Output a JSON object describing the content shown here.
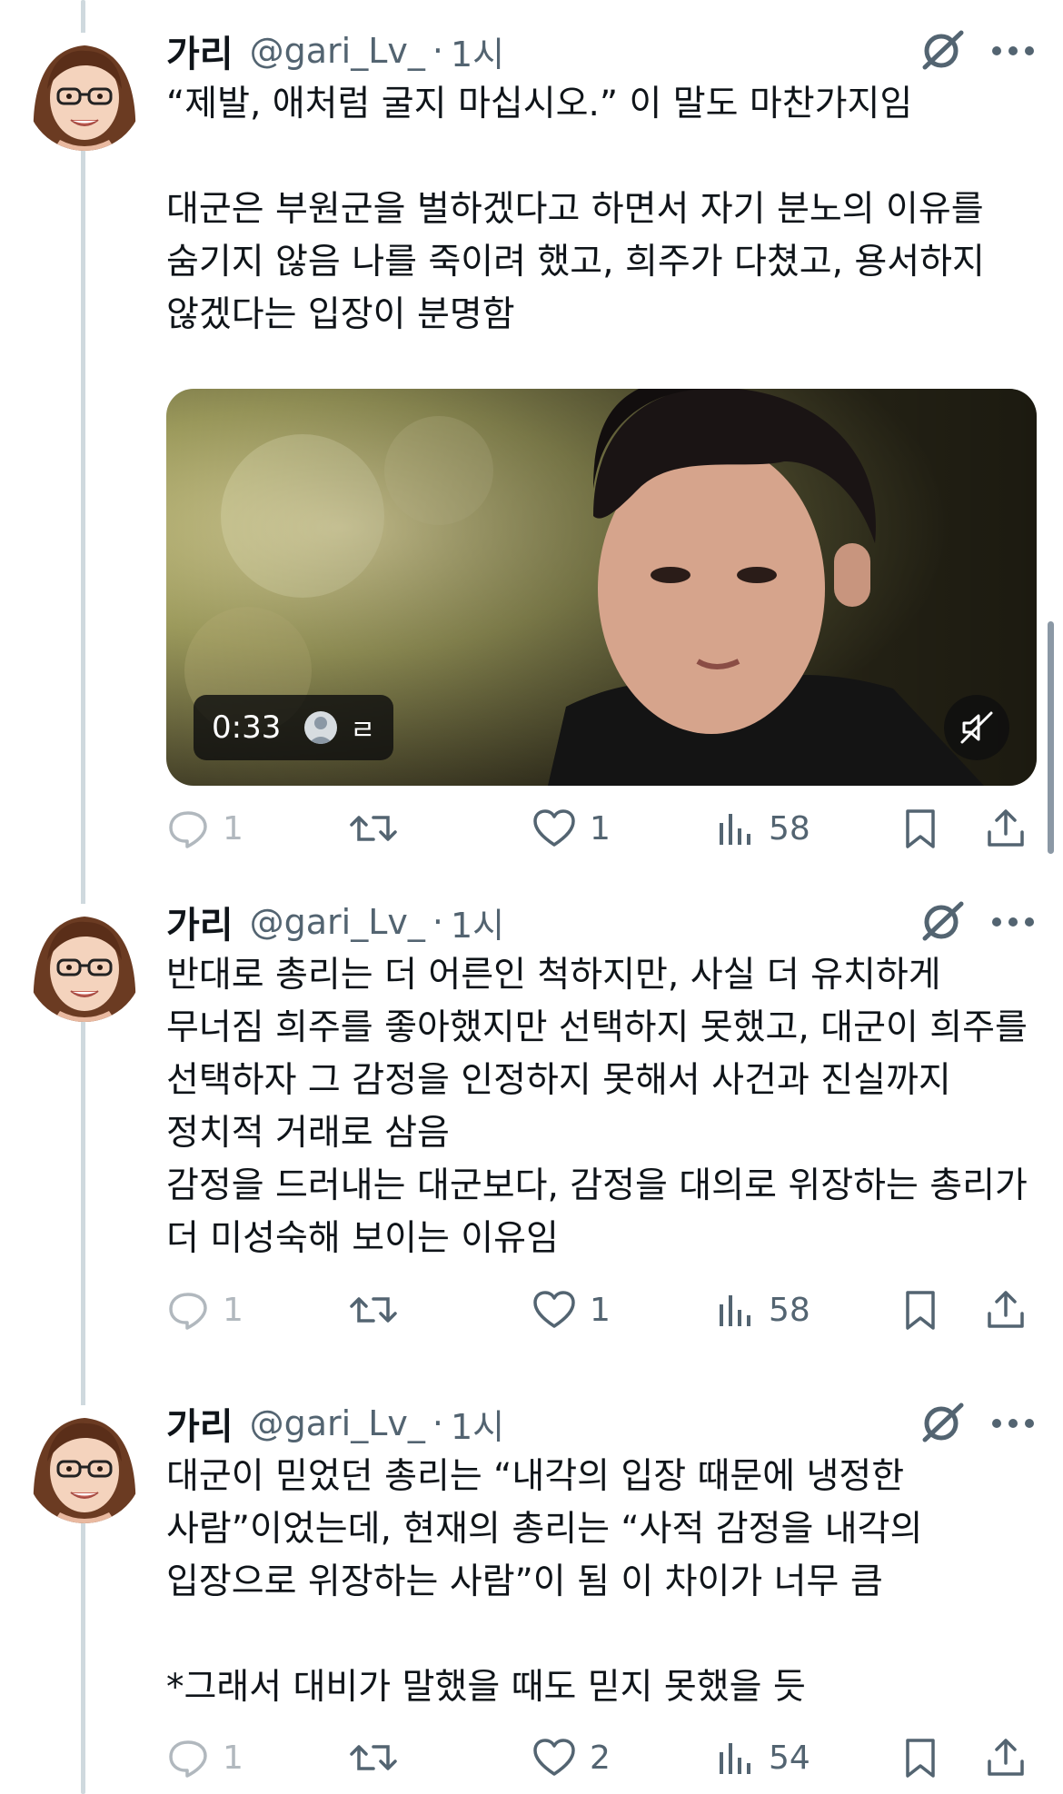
{
  "tweets": [
    {
      "author": "가리",
      "handle": "@gari_Lv_",
      "sep": "·",
      "time": "1시",
      "text": "“제발, 애처럼 굴지 마십시오.” 이 말도 마찬가지임\n\n대군은 부원군을 벌하겠다고 하면서 자기 분노의 이유를 숨기지 않음 나를 죽이려 했고, 희주가 다쳤고, 용서하지 않겠다는 입장이 분명함",
      "video": {
        "duration": "0:33",
        "badge": "ㄹ"
      },
      "replies": "1",
      "likes": "1",
      "views": "58"
    },
    {
      "author": "가리",
      "handle": "@gari_Lv_",
      "sep": "·",
      "time": "1시",
      "text": "반대로 총리는 더 어른인 척하지만, 사실 더 유치하게 무너짐 희주를 좋아했지만 선택하지 못했고, 대군이 희주를 선택하자 그 감정을 인정하지 못해서 사건과 진실까지 정치적 거래로 삼음\n감정을 드러내는 대군보다, 감정을 대의로 위장하는 총리가 더 미성숙해 보이는 이유임",
      "replies": "1",
      "likes": "1",
      "views": "58"
    },
    {
      "author": "가리",
      "handle": "@gari_Lv_",
      "sep": "·",
      "time": "1시",
      "text": "대군이 믿었던 총리는 “내각의 입장 때문에 냉정한 사람”이었는데, 현재의 총리는 “사적 감정을 내각의 입장으로 위장하는 사람”이 됨 이 차이가 너무 큼\n\n*그래서 대비가 말했을 때도 믿지 못했을 듯",
      "replies": "1",
      "likes": "2",
      "views": "54"
    }
  ]
}
